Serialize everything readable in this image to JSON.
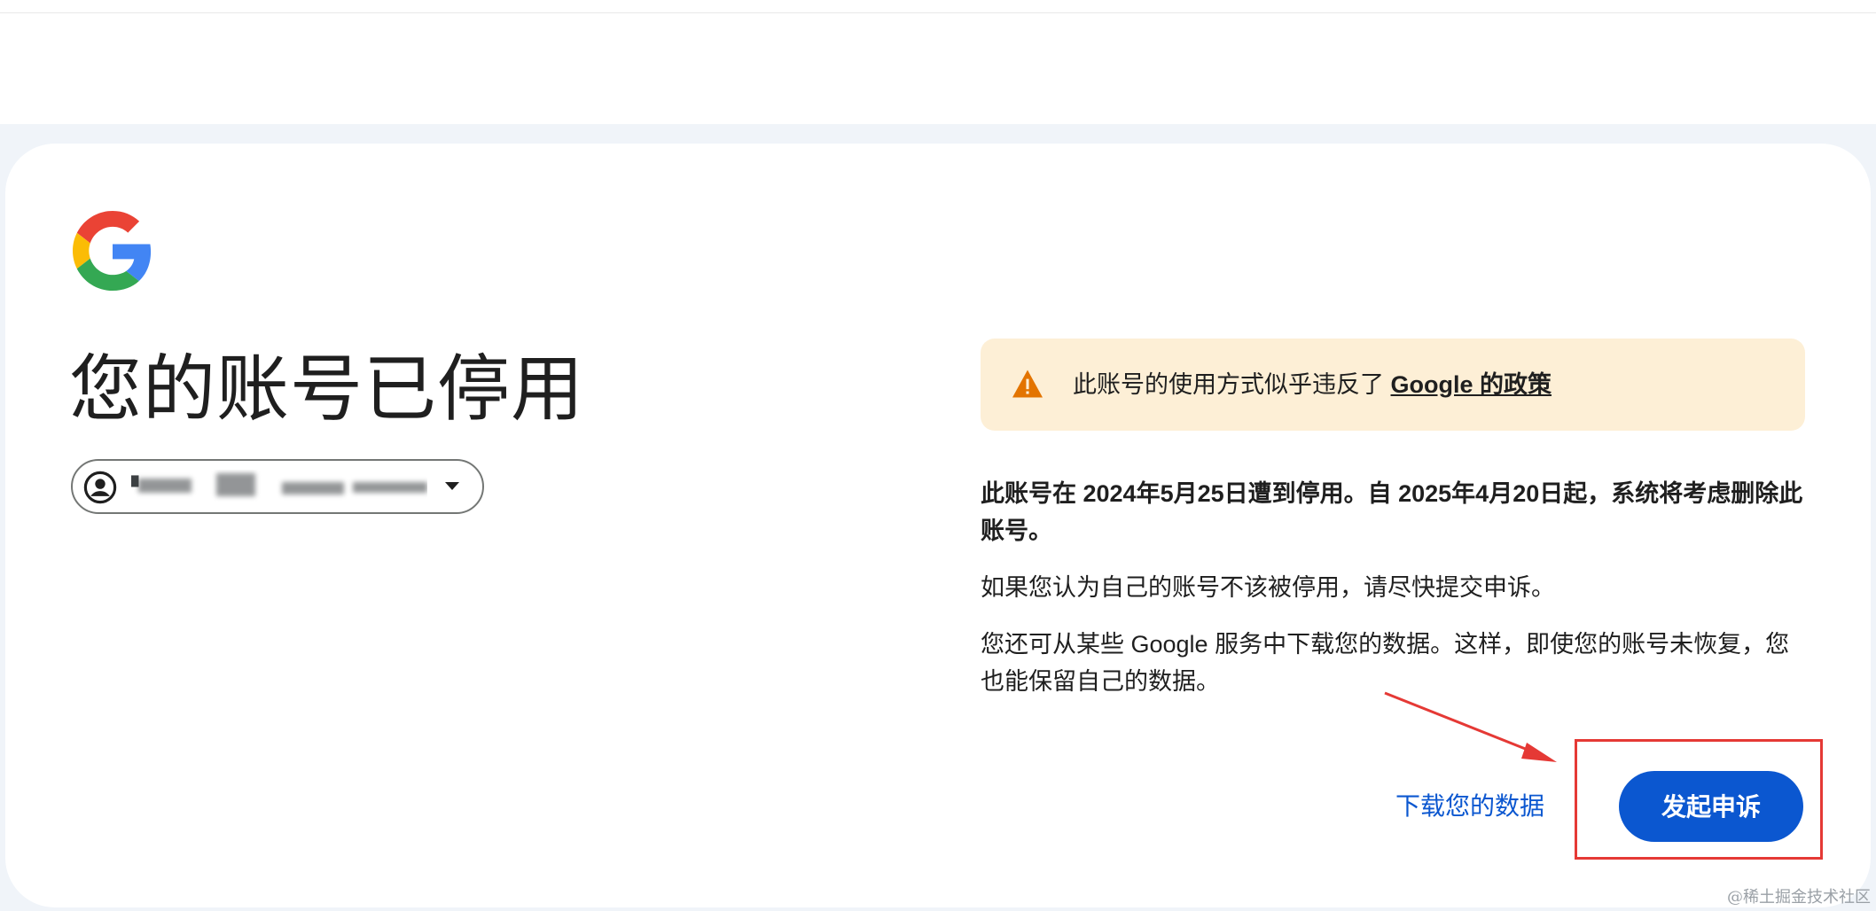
{
  "page": {
    "title": "您的账号已停用",
    "account_email": "▘"
  },
  "warning": {
    "text": "此账号的使用方式似乎违反了 ",
    "link": "Google 的政策"
  },
  "body": {
    "suspend_notice": "此账号在 2024年5月25日遭到停用。自 2025年4月20日起，系统将考虑删除此账号。",
    "appeal_info": "如果您认为自己的账号不该被停用，请尽快提交申诉。",
    "download_info": "您还可从某些 Google 服务中下载您的数据。这样，即使您的账号未恢复，您也能保留自己的数据。"
  },
  "actions": {
    "download_label": "下载您的数据",
    "appeal_label": "发起申诉"
  },
  "watermark": "@稀土掘金技术社区",
  "icons": {
    "logo": "google-logo",
    "avatar": "account-circle-icon",
    "caret": "caret-down-icon",
    "warning": "warning-icon"
  },
  "colors": {
    "primary": "#0b57d0",
    "warning_bg": "#fdefd6",
    "warning_icon": "#e37400",
    "annotation": "#e53935",
    "page_bg": "#f0f4f9"
  }
}
